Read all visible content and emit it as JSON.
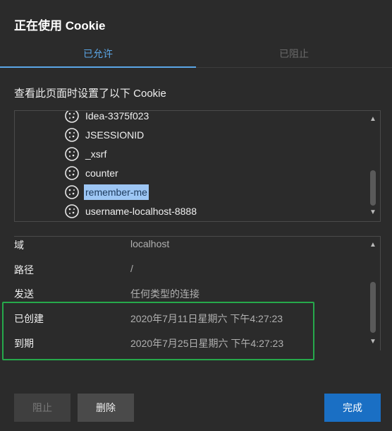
{
  "dialog": {
    "title": "正在使用 Cookie"
  },
  "tabs": [
    {
      "label": "已允许",
      "active": true
    },
    {
      "label": "已阻止",
      "active": false
    }
  ],
  "description": "查看此页面时设置了以下 Cookie",
  "cookie_list": {
    "items": [
      {
        "label": "Idea-3375f023",
        "selected": false
      },
      {
        "label": "JSESSIONID",
        "selected": false
      },
      {
        "label": "_xsrf",
        "selected": false
      },
      {
        "label": "counter",
        "selected": false
      },
      {
        "label": "remember-me",
        "selected": true
      },
      {
        "label": "username-localhost-8888",
        "selected": false
      }
    ],
    "scroll_up": "▲",
    "scroll_down": "▼"
  },
  "details": {
    "rows": [
      {
        "key": "域",
        "value": "localhost"
      },
      {
        "key": "路径",
        "value": "/"
      },
      {
        "key": "发送",
        "value": "任何类型的连接"
      },
      {
        "key": "已创建",
        "value": "2020年7月11日星期六 下午4:27:23"
      },
      {
        "key": "到期",
        "value": "2020年7月25日星期六 下午4:27:23"
      }
    ]
  },
  "buttons": {
    "block": "阻止",
    "delete": "删除",
    "done": "完成"
  },
  "colors": {
    "accent": "#5ba6e6",
    "highlight_border": "#26a94b",
    "primary_button": "#1a6fc4",
    "selection": "#9dc6f4"
  }
}
